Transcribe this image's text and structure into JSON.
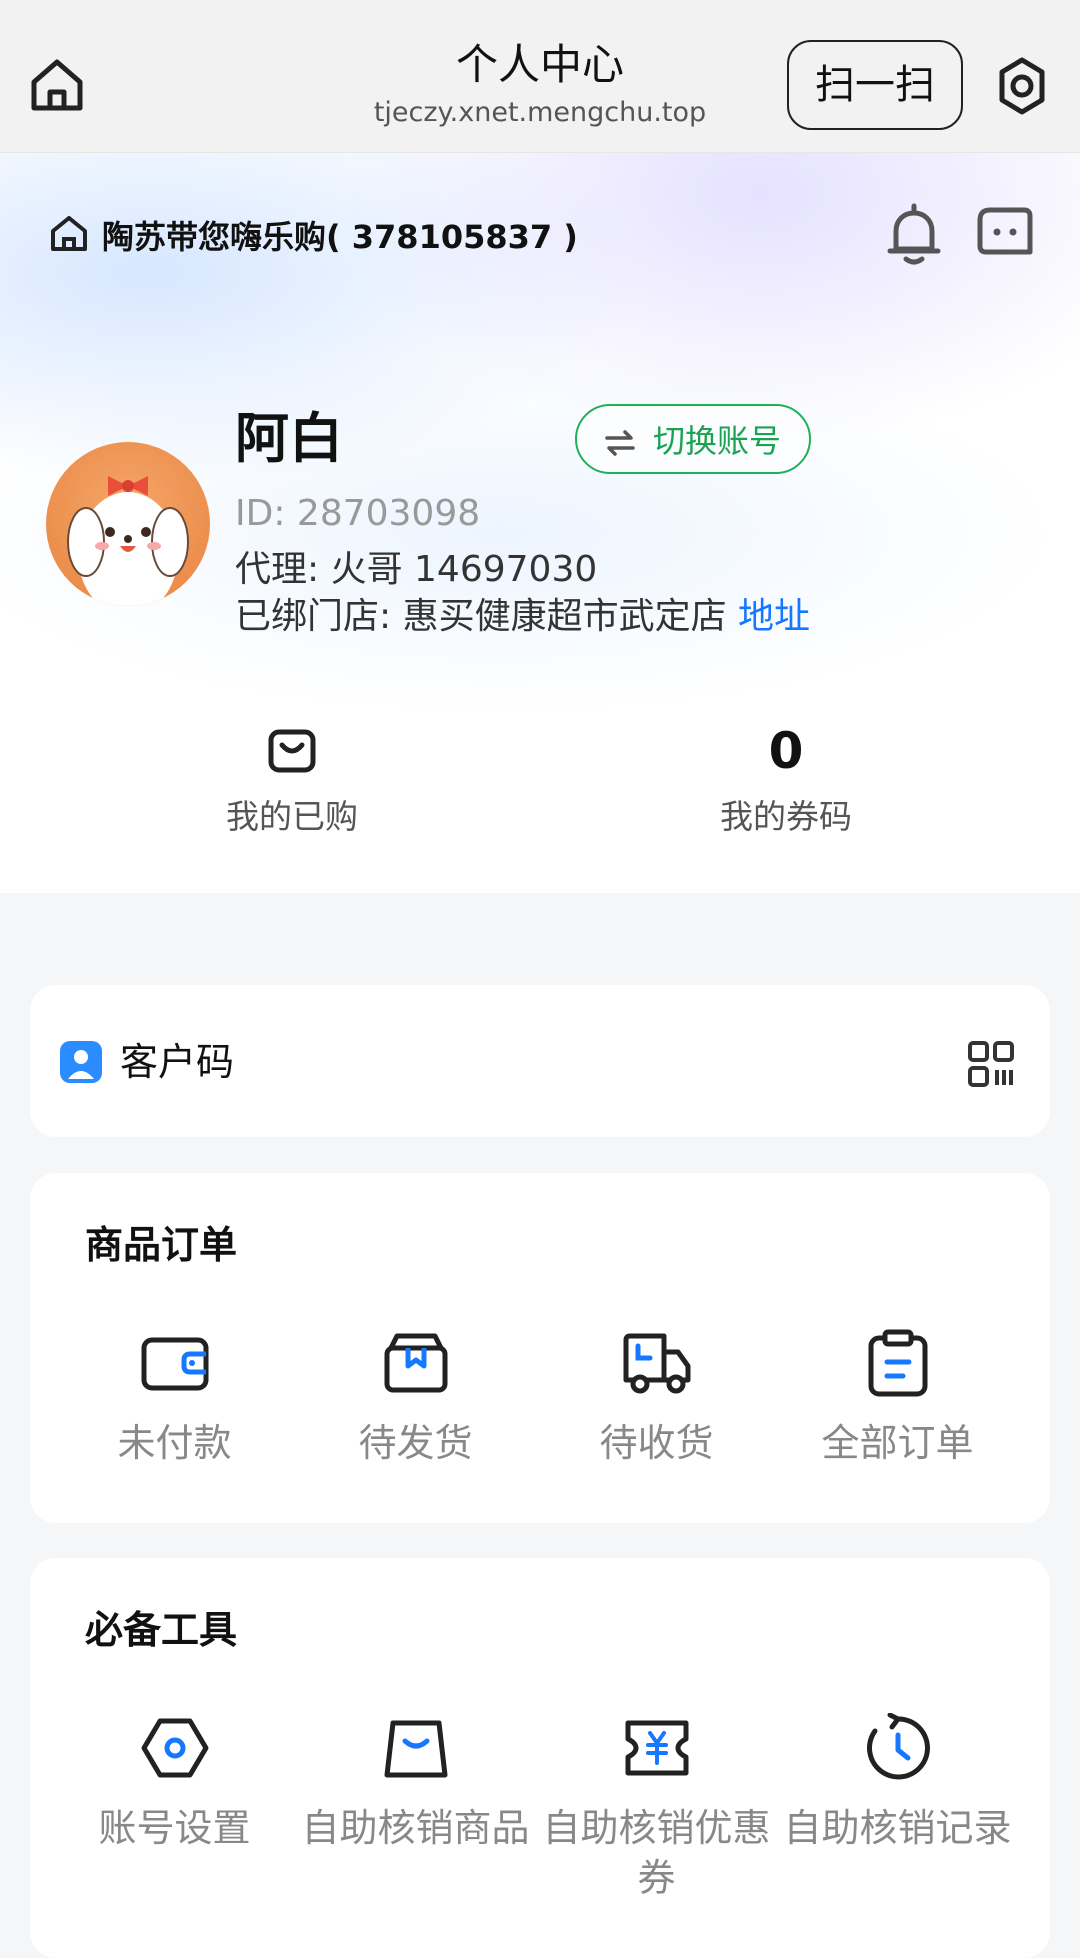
{
  "topbar": {
    "title": "个人中心",
    "url": "tjeczy.xnet.mengchu.top",
    "scan_label": "扫一扫",
    "icons": {
      "home": "home-icon",
      "settings": "gear-icon"
    }
  },
  "store": {
    "name": "陶苏带您嗨乐购( 378105837 )",
    "icons": {
      "store": "home-icon",
      "notify": "bell-icon",
      "message": "chat-icon"
    }
  },
  "profile": {
    "name": "阿白",
    "switch_label": "切换账号",
    "id_text": "ID: 28703098",
    "agent_text": "代理: 火哥 14697030",
    "bound_prefix": "已绑门店: 惠买健康超市武定店",
    "address_link": "地址"
  },
  "stats": {
    "purchased_label": "我的已购",
    "coupons_value": "0",
    "coupons_label": "我的券码"
  },
  "customer_code": {
    "label": "客户码"
  },
  "orders": {
    "title": "商品订单",
    "items": [
      {
        "label": "未付款",
        "icon": "wallet-icon"
      },
      {
        "label": "待发货",
        "icon": "box-icon"
      },
      {
        "label": "待收货",
        "icon": "truck-icon"
      },
      {
        "label": "全部订单",
        "icon": "clipboard-icon"
      }
    ]
  },
  "tools": {
    "title": "必备工具",
    "items": [
      {
        "label": "账号设置",
        "icon": "hexagon-settings-icon"
      },
      {
        "label": "自助核销商品",
        "icon": "bag-icon"
      },
      {
        "label": "自助核销优惠券",
        "icon": "coupon-icon"
      },
      {
        "label": "自助核销记录",
        "icon": "history-icon"
      }
    ]
  },
  "colors": {
    "accent_blue": "#1677ff",
    "accent_green": "#1aa352",
    "icon_dark": "#222222"
  }
}
